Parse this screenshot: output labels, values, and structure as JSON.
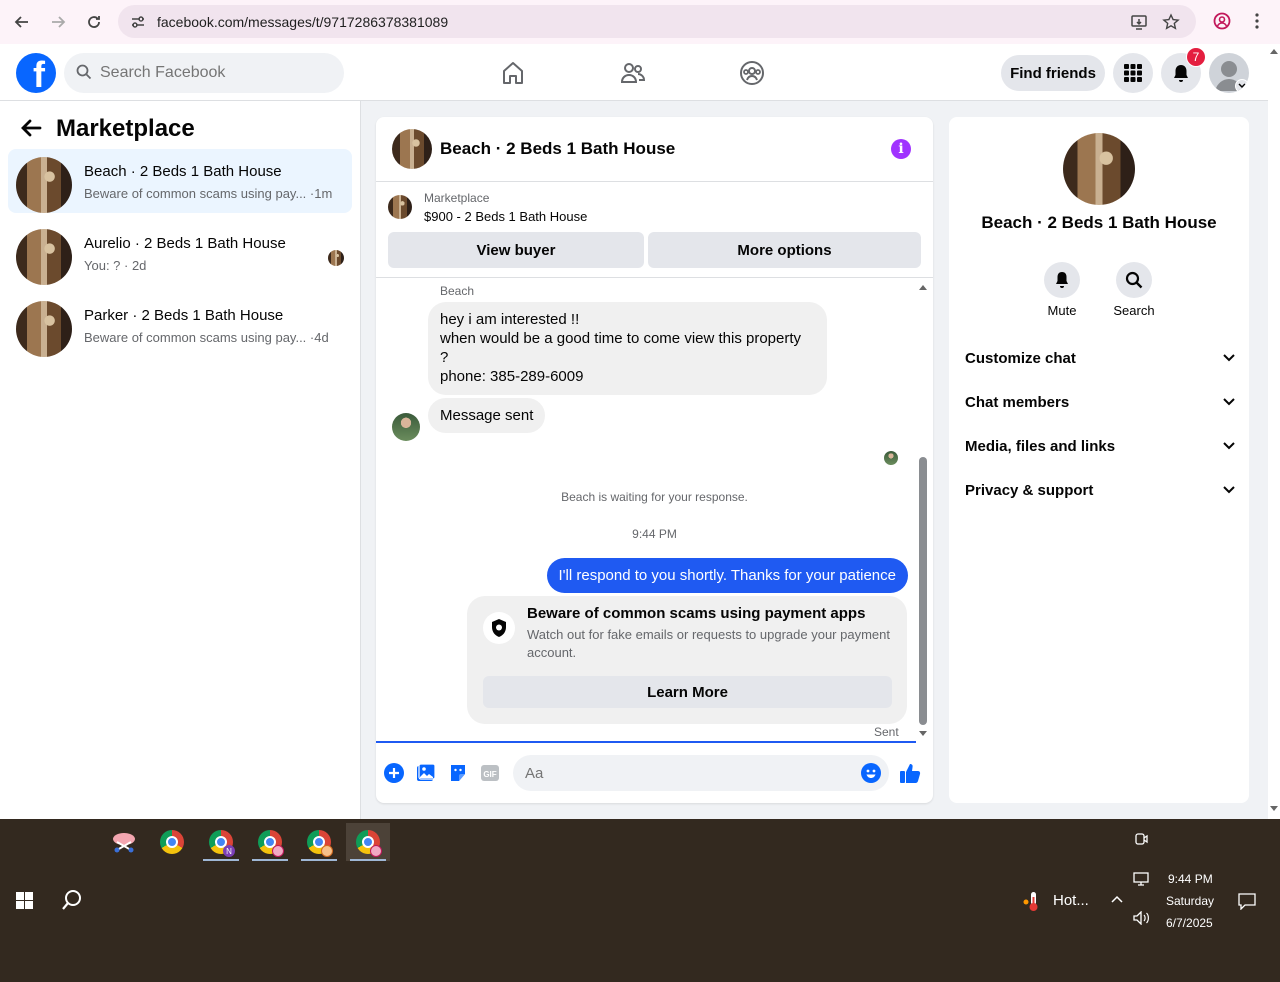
{
  "browser": {
    "url": "facebook.com/messages/t/9717286378381089"
  },
  "header": {
    "search_placeholder": "Search Facebook",
    "find_friends": "Find friends",
    "notification_count": "7",
    "brand_color": "#0866ff"
  },
  "left_panel": {
    "title": "Marketplace",
    "conversations": [
      {
        "name": "Beach · 2 Beds 1 Bath House",
        "preview": "Beware of common scams using pay... ·1m",
        "active": true
      },
      {
        "name": "Aurelio · 2 Beds 1 Bath House",
        "preview": "You: ? · 2d",
        "active": false
      },
      {
        "name": "Parker · 2 Beds 1 Bath House",
        "preview": "Beware of common scams using pay... ·4d",
        "active": false
      }
    ]
  },
  "chat": {
    "title": "Beach · 2 Beds 1 Bath House",
    "banner_label": "Marketplace",
    "banner_listing": "$900 - 2 Beds 1 Bath House",
    "view_buyer": "View buyer",
    "more_options": "More options",
    "sender_name": "Beach",
    "incoming_message": [
      "hey i am interested !!",
      "when would be a good time to come view this property",
      "?",
      "phone: 385-289-6009"
    ],
    "message_sent": "Message sent",
    "waiting_status": "Beach is waiting for your response.",
    "timestamp": "9:44 PM",
    "outgoing_message": "I'll respond to you shortly. Thanks for your patience",
    "scam_title": "Beware of common scams using payment apps",
    "scam_desc": "Watch out for fake emails or requests to upgrade your payment account.",
    "learn_more": "Learn More",
    "sent_label": "Sent",
    "composer_placeholder": "Aa",
    "outgoing_color": "#1f5af2"
  },
  "right_panel": {
    "title": "Beach · 2 Beds 1 Bath House",
    "mute": "Mute",
    "search": "Search",
    "sections": [
      "Customize chat",
      "Chat members",
      "Media, files and links",
      "Privacy & support"
    ]
  },
  "taskbar": {
    "weather": "Hot...",
    "time": "9:44 PM",
    "day": "Saturday",
    "date": "6/7/2025"
  }
}
